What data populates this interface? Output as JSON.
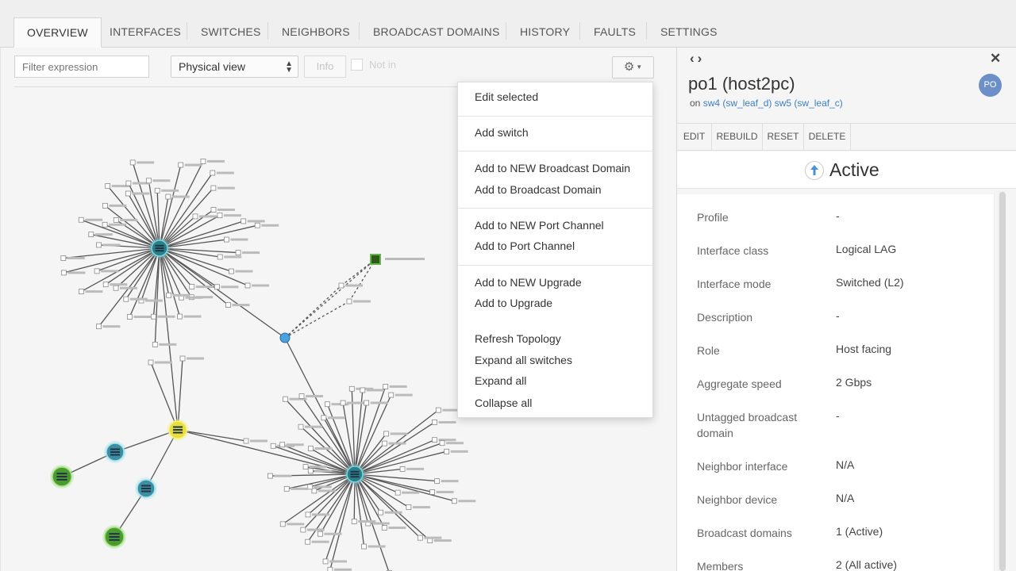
{
  "tabs": [
    {
      "label": "OVERVIEW",
      "active": true
    },
    {
      "label": "INTERFACES"
    },
    {
      "label": "SWITCHES"
    },
    {
      "label": "NEIGHBORS"
    },
    {
      "label": "BROADCAST DOMAINS"
    },
    {
      "label": "HISTORY"
    },
    {
      "label": "FAULTS"
    },
    {
      "label": "SETTINGS"
    }
  ],
  "toolbar": {
    "filter_placeholder": "Filter expression",
    "view_select": "Physical view",
    "info_label": "Info",
    "notin_label": "Not in",
    "gear_icon": "gear-icon"
  },
  "menu": {
    "items": [
      "Edit selected",
      "Add switch",
      "Add to NEW Broadcast Domain",
      "Add to Broadcast Domain",
      "Add to NEW Port Channel",
      "Add to Port Channel",
      "Add to NEW Upgrade",
      "Add to Upgrade",
      "Refresh Topology",
      "Expand all switches",
      "Expand all",
      "Collapse all"
    ]
  },
  "graph": {
    "node_labels": [
      "host2.calvo.inet",
      "po1",
      "sw1",
      "sw4 & sw2",
      "Rack (sw4(l))",
      "Rack (sw1(l))",
      "po2007",
      "po2012",
      "po2011",
      "po2017",
      "uplink1",
      "uplink2"
    ]
  },
  "panel": {
    "title": "po1 (host2pc)",
    "subtitle_prefix": "on",
    "subtitle_link1": "sw4 (sw_leaf_d)",
    "subtitle_link2": "sw5 (sw_leaf_c)",
    "avatar": "PO",
    "actions": [
      "EDIT",
      "REBUILD",
      "RESET",
      "DELETE"
    ],
    "status": "Active",
    "status_color": "#4a90d9",
    "properties": [
      {
        "label": "Profile",
        "value": "-"
      },
      {
        "label": "Interface class",
        "value": "Logical LAG"
      },
      {
        "label": "Interface mode",
        "value": "Switched (L2)"
      },
      {
        "label": "Description",
        "value": "-"
      },
      {
        "label": "Role",
        "value": "Host facing"
      },
      {
        "label": "Aggregate speed",
        "value": "2 Gbps"
      },
      {
        "label": "Untagged broadcast domain",
        "value": "-"
      },
      {
        "label": "Neighbor interface",
        "value": "N/A"
      },
      {
        "label": "Neighbor device",
        "value": "N/A"
      },
      {
        "label": "Broadcast domains",
        "value": "1 (Active)"
      },
      {
        "label": "Members",
        "value": "2 (All active)"
      }
    ]
  }
}
